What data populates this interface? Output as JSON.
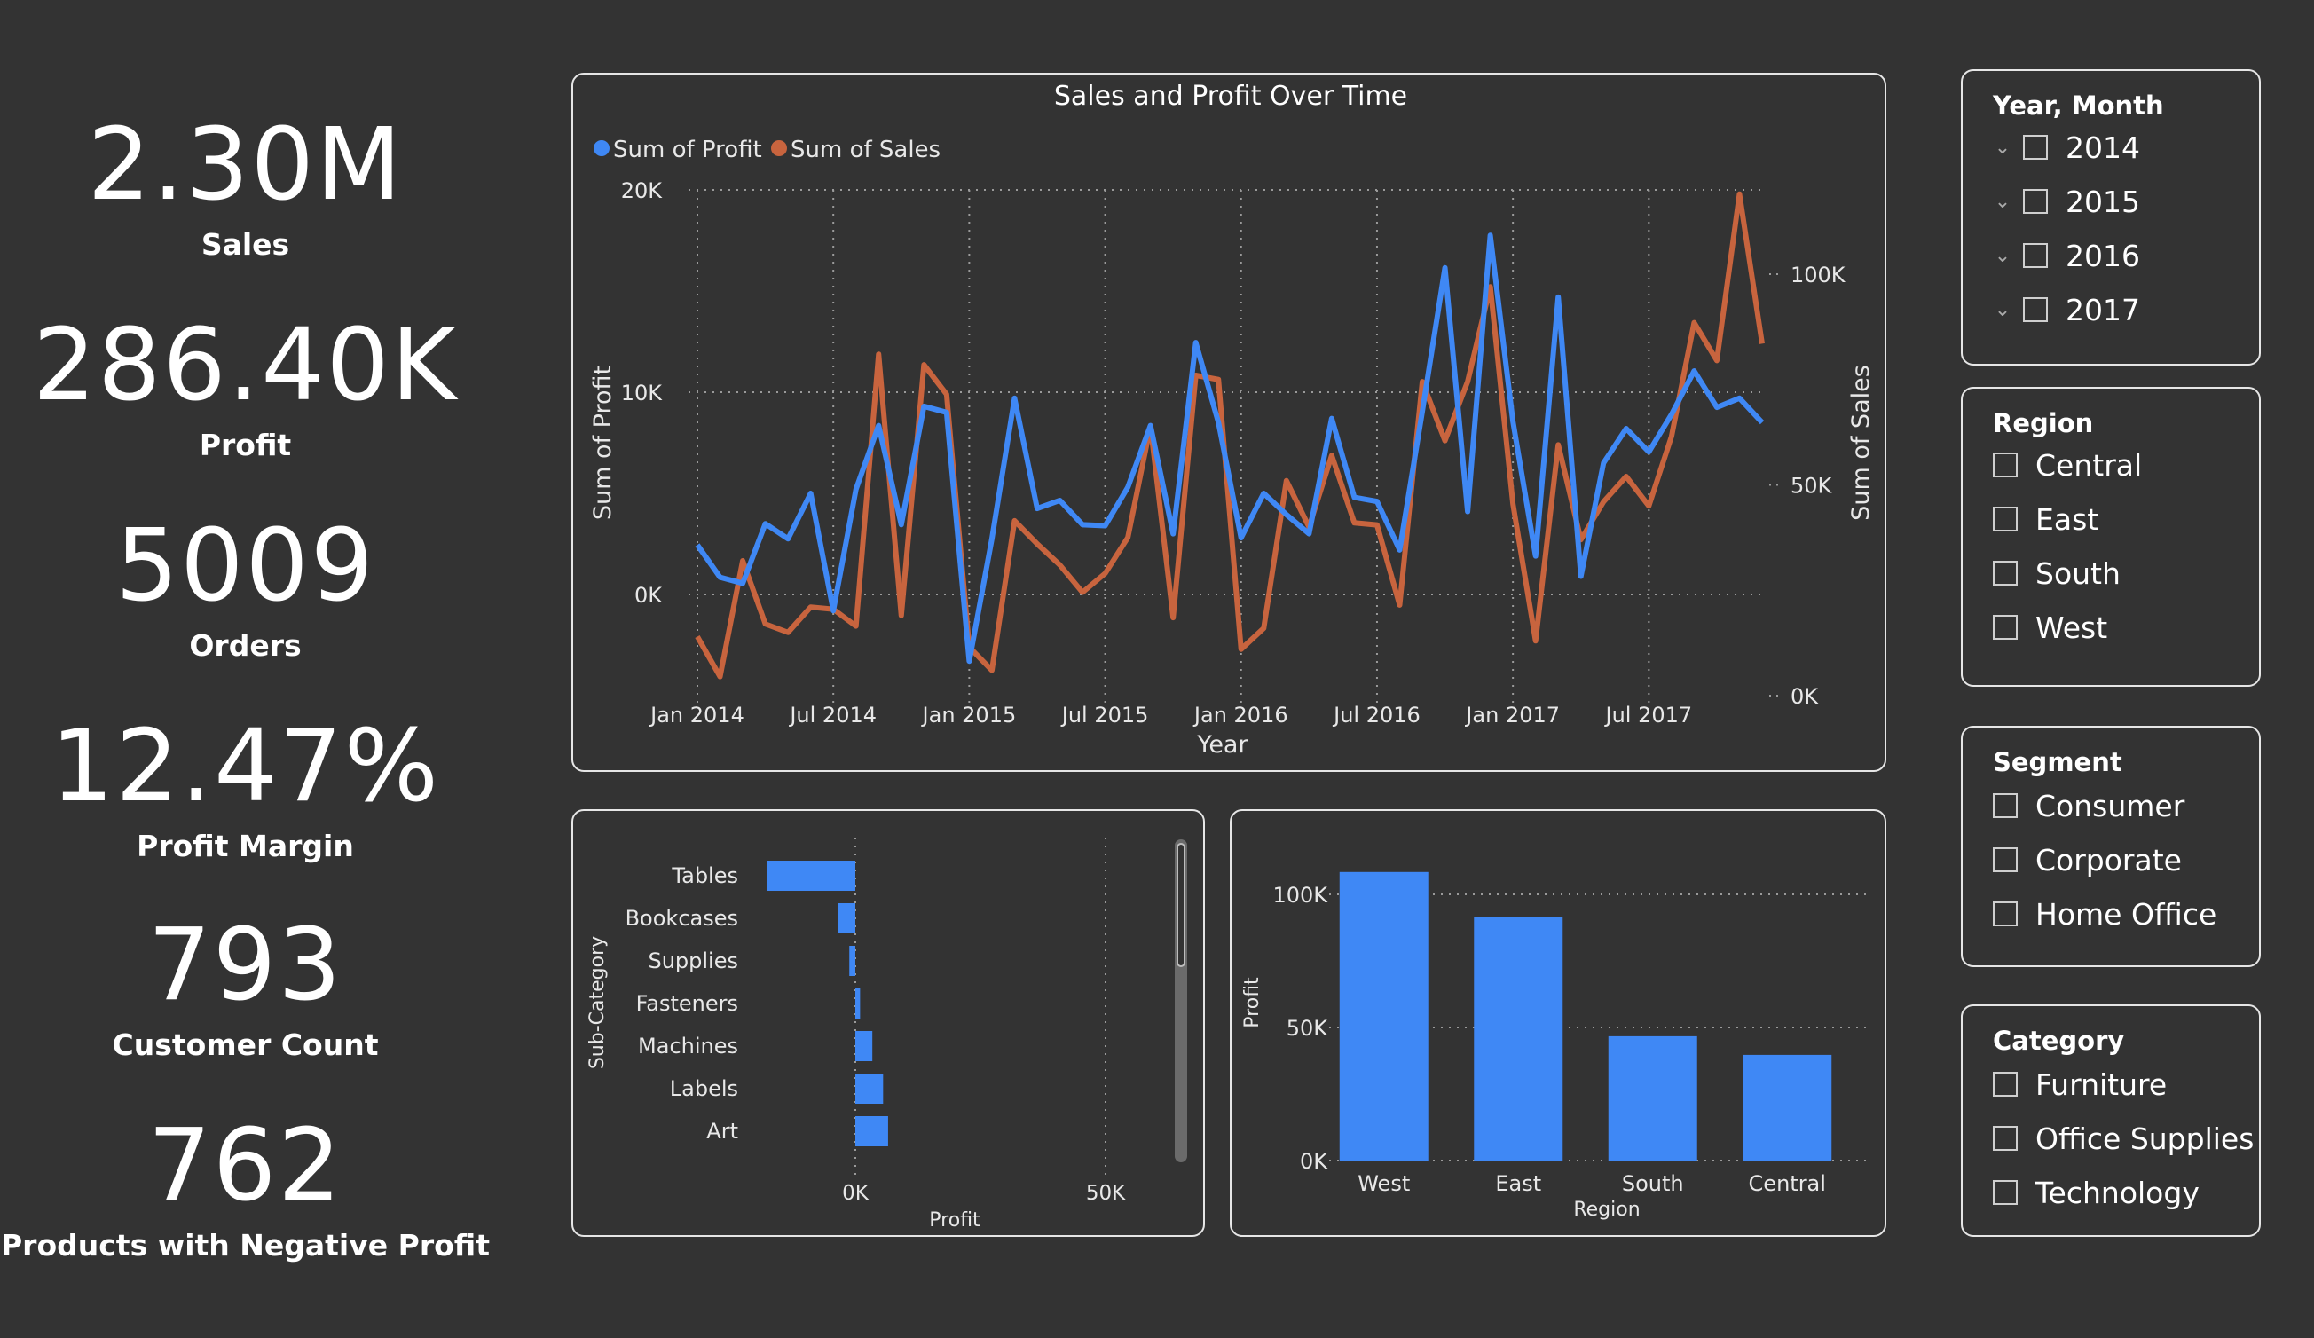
{
  "kpis": [
    {
      "value": "2.30M",
      "label": "Sales"
    },
    {
      "value": "286.40K",
      "label": "Profit"
    },
    {
      "value": "5009",
      "label": "Orders"
    },
    {
      "value": "12.47%",
      "label": "Profit  Margin"
    },
    {
      "value": "793",
      "label": "Customer Count"
    },
    {
      "value": "762",
      "label": "Products with Negative Profit"
    }
  ],
  "slicers": {
    "year_month": {
      "title": "Year, Month",
      "items": [
        "2014",
        "2015",
        "2016",
        "2017"
      ]
    },
    "region": {
      "title": "Region",
      "items": [
        "Central",
        "East",
        "South",
        "West"
      ]
    },
    "segment": {
      "title": "Segment",
      "items": [
        "Consumer",
        "Corporate",
        "Home Office"
      ]
    },
    "category": {
      "title": "Category",
      "items": [
        "Furniture",
        "Office Supplies",
        "Technology"
      ]
    }
  },
  "colors": {
    "profit": "#3f88f5",
    "sales": "#c8643e",
    "background": "#333333",
    "border": "#e6e6e6"
  },
  "chart_data": [
    {
      "type": "line",
      "title": "Sales and Profit Over Time",
      "xlabel": "Year",
      "ylabel": "Sum of Profit",
      "y2label": "Sum of Sales",
      "x_ticks": [
        "Jan 2014",
        "Jul 2014",
        "Jan 2015",
        "Jul 2015",
        "Jan 2016",
        "Jul 2016",
        "Jan 2017",
        "Jul 2017"
      ],
      "y_ticks": [
        "20K",
        "10K",
        "0K"
      ],
      "y2_ticks": [
        "100K",
        "50K",
        "0K"
      ],
      "ylim": [
        -5000,
        20000
      ],
      "y2lim": [
        0,
        120000
      ],
      "legend_position": "top-left",
      "grid": true,
      "series": [
        {
          "name": "Sum of Profit",
          "axis": "left",
          "values": [
            2450,
            850,
            550,
            3500,
            2750,
            5000,
            -800,
            5200,
            8350,
            3450,
            9300,
            9000,
            -3300,
            2750,
            9700,
            4250,
            4650,
            3450,
            3400,
            5300,
            8350,
            3000,
            12450,
            8500,
            2800,
            5000,
            3950,
            3000,
            8700,
            4800,
            4600,
            2200,
            9050,
            16150,
            4100,
            17750,
            8550,
            1900,
            14700,
            900,
            6500,
            8200,
            7050,
            8900,
            11050,
            9250,
            9700,
            8500
          ]
        },
        {
          "name": "Sum of Sales",
          "axis": "right",
          "values": [
            14000,
            4500,
            32000,
            17000,
            15000,
            21000,
            20500,
            16500,
            81000,
            19000,
            78500,
            71500,
            11500,
            6000,
            41500,
            36000,
            31000,
            24500,
            29000,
            37500,
            64000,
            18500,
            76000,
            75000,
            11000,
            16000,
            51000,
            40000,
            57000,
            41000,
            40500,
            21500,
            74500,
            60500,
            74500,
            97000,
            45500,
            13000,
            59500,
            37000,
            46000,
            52000,
            45000,
            61500,
            88500,
            79500,
            119000,
            83500
          ]
        }
      ]
    },
    {
      "type": "bar",
      "orientation": "horizontal",
      "xlabel": "Profit",
      "ylabel": "Sub-Category",
      "categories": [
        "Tables",
        "Bookcases",
        "Supplies",
        "Fasteners",
        "Machines",
        "Labels",
        "Art"
      ],
      "values": [
        -17700,
        -3500,
        -1200,
        950,
        3400,
        5550,
        6550
      ],
      "x_ticks": [
        "0K",
        "50K"
      ],
      "xlim": [
        -18000,
        55000
      ]
    },
    {
      "type": "bar",
      "xlabel": "Region",
      "ylabel": "Profit",
      "categories": [
        "West",
        "East",
        "South",
        "Central"
      ],
      "values": [
        108400,
        91500,
        46700,
        39700
      ],
      "y_ticks": [
        "100K",
        "50K",
        "0K"
      ],
      "ylim": [
        0,
        100000
      ]
    }
  ]
}
